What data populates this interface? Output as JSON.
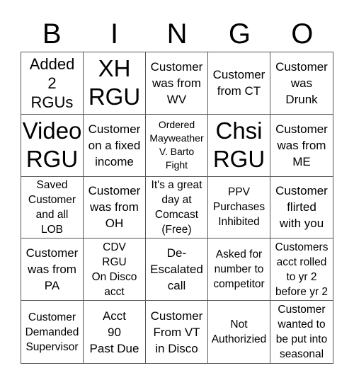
{
  "header": {
    "letters": [
      "B",
      "I",
      "N",
      "G",
      "O"
    ]
  },
  "card": {
    "rows": [
      [
        {
          "text": "Added\n2\nRGUs",
          "size": "l"
        },
        {
          "text": "XH\nRGU",
          "size": "xl"
        },
        {
          "text": "Customer\nwas from\nWV",
          "size": "m"
        },
        {
          "text": "Customer\nfrom CT",
          "size": "m"
        },
        {
          "text": "Customer\nwas\nDrunk",
          "size": "m"
        }
      ],
      [
        {
          "text": "Video\nRGU",
          "size": "xl"
        },
        {
          "text": "Customer\non a fixed\nincome",
          "size": "m"
        },
        {
          "text": "Ordered\nMayweather\nV. Barto\nFight",
          "size": "xs"
        },
        {
          "text": "Chsi\nRGU",
          "size": "xl"
        },
        {
          "text": "Customer\nwas from\nME",
          "size": "m"
        }
      ],
      [
        {
          "text": "Saved\nCustomer\nand all\nLOB",
          "size": "s"
        },
        {
          "text": "Customer\nwas from\nOH",
          "size": "m"
        },
        {
          "text": "It's a great\nday at\nComcast\n(Free)",
          "size": "s"
        },
        {
          "text": "PPV\nPurchases\nInhibited",
          "size": "s"
        },
        {
          "text": "Customer\nflirted\nwith you",
          "size": "m"
        }
      ],
      [
        {
          "text": "Customer\nwas from\nPA",
          "size": "m"
        },
        {
          "text": "CDV\nRGU\nOn Disco\nacct",
          "size": "s"
        },
        {
          "text": "De-\nEscalated\ncall",
          "size": "m"
        },
        {
          "text": "Asked for\nnumber to\ncompetitor",
          "size": "s"
        },
        {
          "text": "Customers\nacct rolled\nto yr 2\nbefore yr 2",
          "size": "s"
        }
      ],
      [
        {
          "text": "Customer\nDemanded\nSupervisor",
          "size": "s"
        },
        {
          "text": "Acct\n90\nPast Due",
          "size": "m"
        },
        {
          "text": "Customer\nFrom VT\nin Disco",
          "size": "m"
        },
        {
          "text": "Not\nAuthorizied",
          "size": "s"
        },
        {
          "text": "Customer\nwanted to\nbe put into\nseasonal",
          "size": "s"
        }
      ]
    ]
  }
}
